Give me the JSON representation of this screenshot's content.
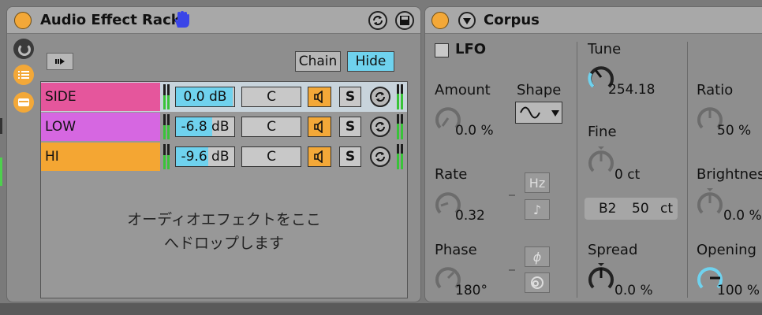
{
  "rack": {
    "title": "Audio Effect Rack",
    "chain_label": "Chain",
    "hide_label": "Hide",
    "drop_line1": "オーディオエフェクトをここ",
    "drop_line2": "へドロップします",
    "chains": [
      {
        "name": "SIDE",
        "volume": "0.0 dB",
        "pan": "C",
        "solo": "S",
        "color": "#e5569c",
        "vol_level": 0.97
      },
      {
        "name": "LOW",
        "volume": "-6.8 dB",
        "pan": "C",
        "solo": "S",
        "color": "#d667e1",
        "vol_level": 0.62
      },
      {
        "name": "HI",
        "volume": "-9.6 dB",
        "pan": "C",
        "solo": "S",
        "color": "#f4a633",
        "vol_level": 0.56
      }
    ]
  },
  "corpus": {
    "title": "Corpus",
    "lfo_label": "LFO",
    "amount_label": "Amount",
    "amount_value": "0.0 %",
    "shape_label": "Shape",
    "rate_label": "Rate",
    "rate_value": "0.32",
    "hz_label": "Hz",
    "note_glyph": "♪",
    "phase_label": "Phase",
    "phase_value": "180°",
    "phi_glyph": "ϕ",
    "tune_label": "Tune",
    "tune_value": "254.18",
    "fine_label": "Fine",
    "fine_value": "0 ct",
    "note_name": "B2",
    "note_cents": "50",
    "note_unit": "ct",
    "spread_label": "Spread",
    "spread_value": "0.0 %",
    "ratio_label": "Ratio",
    "ratio_value": "50 %",
    "brightness_label": "Brightness",
    "brightness_value": "0.0 %",
    "opening_label": "Opening",
    "opening_value": "100 %"
  },
  "colors": {
    "accent": "#6fd2ee",
    "power": "#f3a838",
    "panel": "#8e8e8e"
  }
}
